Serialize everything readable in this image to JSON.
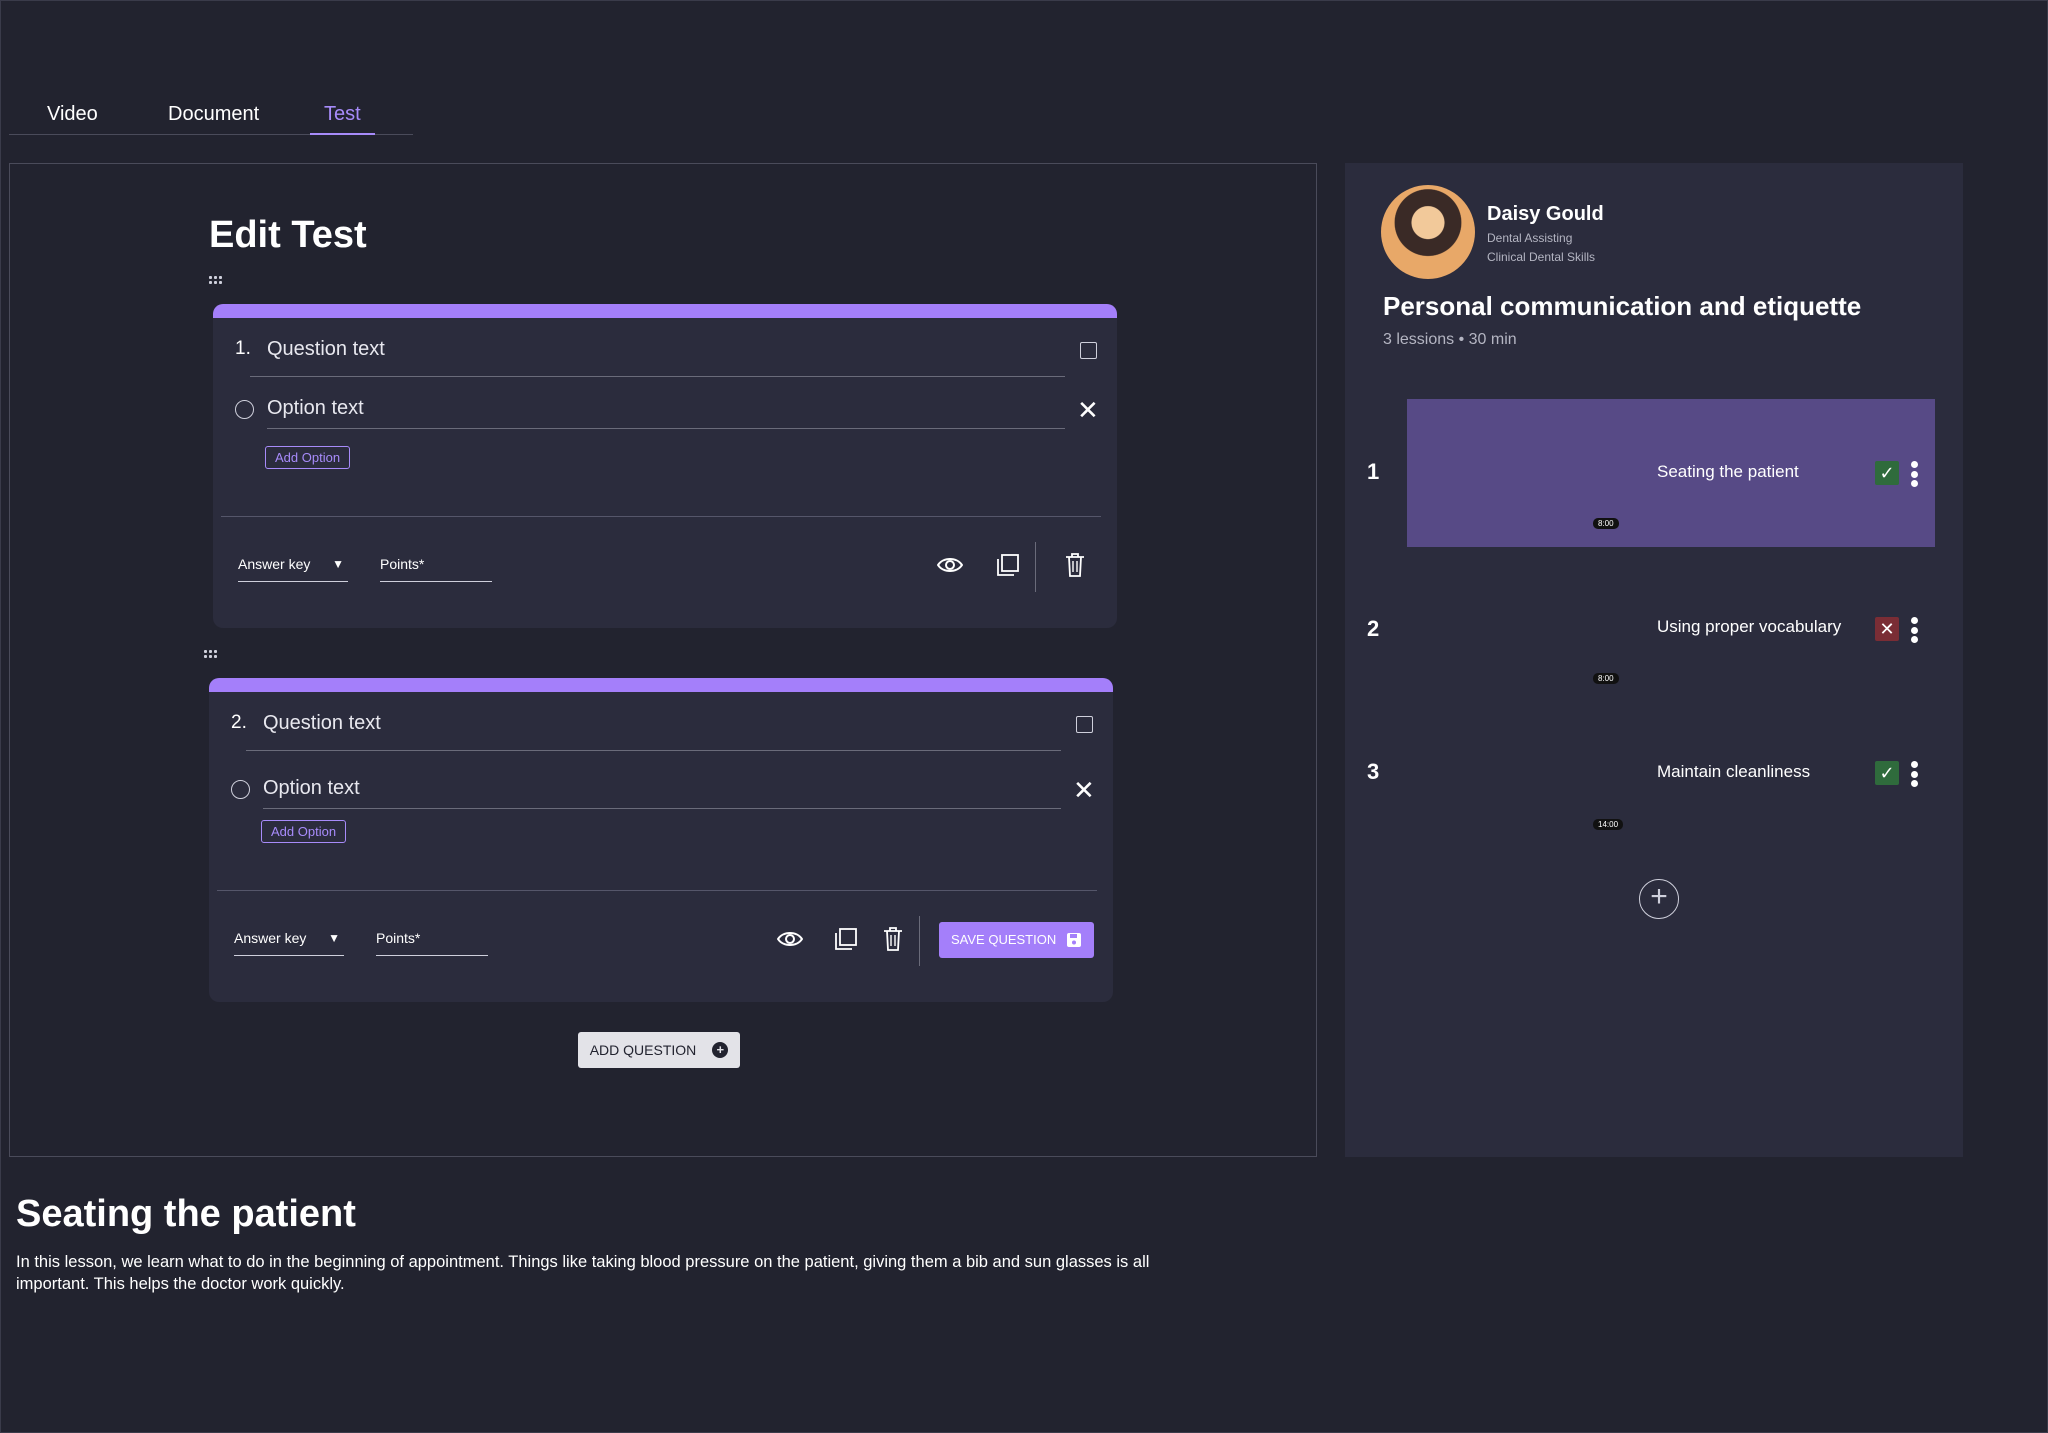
{
  "tabs": [
    {
      "label": "Video",
      "active": false
    },
    {
      "label": "Document",
      "active": false
    },
    {
      "label": "Test",
      "active": true
    }
  ],
  "editor": {
    "title": "Edit Test",
    "questions": [
      {
        "number": "1.",
        "question_placeholder": "Question text",
        "option_placeholder": "Option text",
        "add_option_label": "Add Option",
        "answer_key_label": "Answer key",
        "points_label": "Points*"
      },
      {
        "number": "2.",
        "question_placeholder": "Question text",
        "option_placeholder": "Option text",
        "add_option_label": "Add Option",
        "answer_key_label": "Answer key",
        "points_label": "Points*",
        "save_label": "SAVE QUESTION"
      }
    ],
    "add_question_label": "ADD QUESTION"
  },
  "sidebar": {
    "user": {
      "name": "Daisy Gould",
      "program": "Dental Assisting",
      "course_group": "Clinical Dental Skills"
    },
    "course": {
      "title": "Personal communication and etiquette",
      "meta": "3 lessions • 30 min"
    },
    "lessons": [
      {
        "number": "1",
        "name": "Seating the patient",
        "duration": "8:00",
        "status": "complete",
        "active": true
      },
      {
        "number": "2",
        "name": "Using proper vocabulary",
        "duration": "8:00",
        "status": "failed",
        "active": false
      },
      {
        "number": "3",
        "name": "Maintain cleanliness",
        "duration": "14:00",
        "status": "complete",
        "active": false
      }
    ]
  },
  "lesson_detail": {
    "title": "Seating the patient",
    "description": "In this lesson, we learn what to do in the beginning of appointment.  Things like taking blood pressure on the patient, giving them a bib and sun glasses is all important.  This helps the doctor work quickly."
  },
  "colors": {
    "background": "#22232f",
    "panel": "#2b2c3d",
    "accent": "#a47ffa",
    "active_lesson": "#574a86",
    "success": "#2f6b3c",
    "error": "#7a2d35"
  }
}
